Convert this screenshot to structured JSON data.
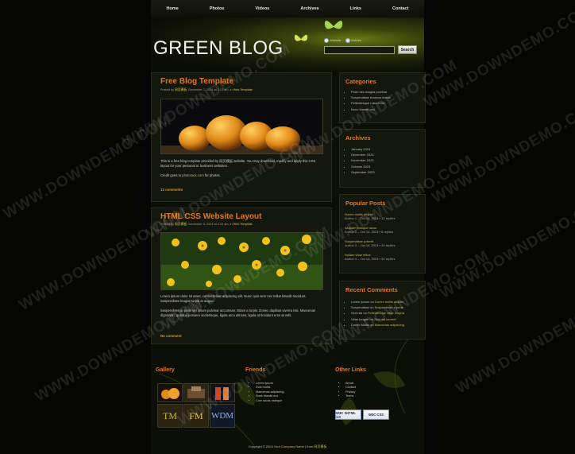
{
  "nav": {
    "items": [
      "Home",
      "Photos",
      "Videos",
      "Archives",
      "Links",
      "Contact"
    ]
  },
  "header": {
    "logo": "GREEN BLOG",
    "search": {
      "option_1": "Website",
      "option_2": "Entries",
      "button": "Search",
      "placeholder": ""
    }
  },
  "posts": [
    {
      "title": "Free Blog Template",
      "meta_prefix": "Posted by ",
      "author": "网页模板",
      "meta_middle": ", December 7, 2024 at 2:13 am, in ",
      "category": "Web Template",
      "text": "This is a free blog template provided by 网页模板 website. You may download, modify and apply this CSS layout for your personal or business websites.",
      "credit_prefix": "Credit goes to ",
      "credit_link": "photorack.com",
      "credit_suffix": " for photos.",
      "link": "12 comments"
    },
    {
      "title": "HTML CSS Website Layout",
      "meta_prefix": "Posted by ",
      "author": "网页模板",
      "meta_middle": ", December 5, 2024 at 2:15 am, in ",
      "category": "Web Template",
      "text": "Lorem ipsum dolor sit amet, consectetuer adipiscing elit. Nunc quis sem nec tellus blandit tincidunt. Suspendisse feugiat turpis at augue.",
      "text2": "Suspendisse at pede vel ipsum pulvinar accumsan. Etiam a turpis. Donec dapibus viverra nisi. Maecenas dignissim, quam a posuere scelerisque, ligula arcu ultrices, ligula at tincidunt eros at velit.",
      "link": "No comment"
    }
  ],
  "sidebar": {
    "categories": {
      "title": "Categories",
      "items": [
        "Proin nec magna pulvinar",
        "Suspendisse rhoncus lectus",
        "Pellentesque rutrum est",
        "Nunc blandit orci"
      ]
    },
    "archives": {
      "title": "Archives",
      "items": [
        "January 2024",
        "December 2023",
        "November 2023",
        "October 2023",
        "September 2023"
      ]
    },
    "popular": {
      "title": "Popular Posts",
      "items": [
        {
          "title": "Donec mollis aliquet",
          "sub": "Author 1 – Oct 14, 2024",
          "replies": "12 replies"
        },
        {
          "title": "Aliquam tristique lacus",
          "sub": "Author 2 – Oct 14, 2024",
          "replies": "8 replies"
        },
        {
          "title": "Suspendisse potenti",
          "sub": "Author 3 – Oct 14, 2024",
          "replies": "10 replies"
        },
        {
          "title": "Nullam vitae tellus",
          "sub": "Author 4 – Oct 14, 2024",
          "replies": "30 replies"
        }
      ]
    },
    "recent": {
      "title": "Recent Comments",
      "items": [
        {
          "name": "Lorem Ipsum",
          "on": " on ",
          "post": "Donec mollis aliquet"
        },
        {
          "name": "Suspendisse",
          "on": " on ",
          "post": "Suspendisse a pede"
        },
        {
          "name": "Sed nisi",
          "on": " on ",
          "post": "Pellentesque vitae magna"
        },
        {
          "name": "Vitae tongue",
          "on": " on ",
          "post": "Sed nisi laoreet"
        },
        {
          "name": "Donec Mollis",
          "on": " on ",
          "post": "Maecenas adipiscing"
        }
      ]
    }
  },
  "footer": {
    "gallery": {
      "title": "Gallery",
      "labels": [
        "TM",
        "FM",
        "WDM"
      ]
    },
    "friends": {
      "title": "Friends",
      "items": [
        "Lorem ipsum",
        "Duis mollis",
        "Maecenas adipiscing",
        "Nunc blandit orci",
        "Cum sociis natoque"
      ]
    },
    "other": {
      "title": "Other Links",
      "items": [
        "About",
        "Contact",
        "Privacy",
        "Terms"
      ]
    },
    "badges": [
      "W3C XHTML 1.0",
      "W3C CSS"
    ],
    "copyright_prefix": "Copyright © 2024 ",
    "company": "Your Company Name",
    "copyright_mid": " | from ",
    "source": "网页模板"
  },
  "watermark": "WWW.DOWNDEMO.COM",
  "colors": {
    "accent": "#e07a1a",
    "link": "#c9b75a",
    "background": "#050604",
    "panel": "#14170d"
  }
}
